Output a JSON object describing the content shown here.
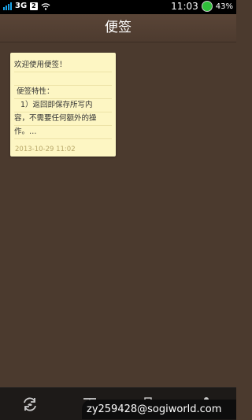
{
  "status_bar": {
    "network": "3G",
    "sim": "2",
    "time": "11:03",
    "battery": "43%"
  },
  "header": {
    "title": "便签"
  },
  "note": {
    "lines": [
      "欢迎使用便签！",
      "",
      "便签特性：",
      "1）返回即保存所写内",
      "容，不需要任何额外的操",
      "作。…"
    ],
    "date": "2013-10-29 11:02"
  },
  "toolbar": {
    "icons": [
      "sync-icon",
      "text-icon",
      "camera-icon",
      "microphone-icon"
    ]
  },
  "watermark": {
    "text": "zy259428@sogiworld.com"
  }
}
